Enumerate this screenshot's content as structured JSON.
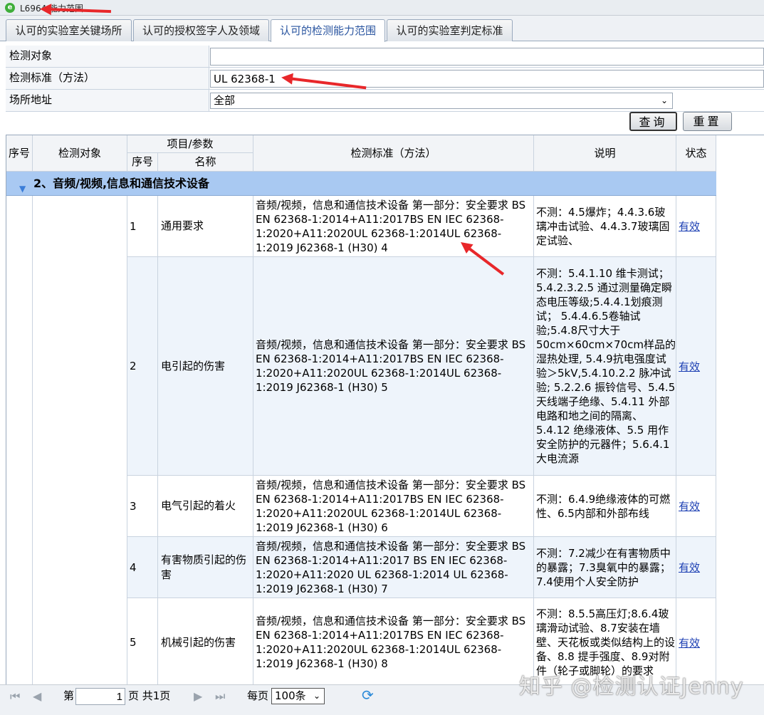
{
  "window": {
    "title": "L6964 能力范围"
  },
  "tabs": [
    {
      "label": "认可的实验室关键场所"
    },
    {
      "label": "认可的授权签字人及领域"
    },
    {
      "label": "认可的检测能力范围"
    },
    {
      "label": "认可的实验室判定标准"
    }
  ],
  "form": {
    "object_label": "检测对象",
    "object_value": "",
    "standard_label": "检测标准（方法）",
    "standard_value": "UL 62368-1",
    "site_label": "场所地址",
    "site_value": "全部",
    "query_label": "查询",
    "reset_label": "重置"
  },
  "grid": {
    "headers": {
      "seq": "序号",
      "object": "检测对象",
      "item_param": "项目/参数",
      "item_seq": "序号",
      "item_name": "名称",
      "standard": "检测标准（方法）",
      "note": "说明",
      "status": "状态"
    },
    "group_title": "2、音频/视频,信息和通信技术设备",
    "rows": [
      {
        "no": "1",
        "name": "通用要求",
        "standard": "音频/视频，信息和通信技术设备 第一部分：安全要求 BS EN 62368-1:2014+A11:2017BS EN IEC 62368-1:2020+A11:2020UL 62368-1:2014UL 62368-1:2019 J62368-1 (H30) 4",
        "note": "不测：4.5爆炸；4.4.3.6玻璃冲击试验、4.4.3.7玻璃固定试验、",
        "status": "有效"
      },
      {
        "no": "2",
        "name": "电引起的伤害",
        "standard": "音频/视频，信息和通信技术设备 第一部分：安全要求 BS EN 62368-1:2014+A11:2017BS EN IEC 62368-1:2020+A11:2020UL 62368-1:2014UL 62368-1:2019 J62368-1 (H30) 5",
        "note": "不测：5.4.1.10 维卡测试； 5.4.2.3.2.5 通过测量确定瞬态电压等级;5.4.4.1划痕测试； 5.4.4.6.5卷轴试验;5.4.8尺寸大于50cm×60cm×70cm样品的湿热处理, 5.4.9抗电强度试验＞5kV,5.4.10.2.2 脉冲试验; 5.2.2.6 振铃信号、5.4.5 天线端子绝缘、5.4.11 外部电路和地之间的隔离、5.4.12 绝缘液体、5.5 用作安全防护的元器件；5.6.4.1大电流源",
        "status": "有效"
      },
      {
        "no": "3",
        "name": "电气引起的着火",
        "standard": "音频/视频，信息和通信技术设备 第一部分：安全要求 BS EN 62368-1:2014+A11:2017BS EN IEC 62368-1:2020+A11:2020UL 62368-1:2014UL 62368-1:2019 J62368-1 (H30) 6",
        "note": "不测：6.4.9绝缘液体的可燃性、6.5内部和外部布线",
        "status": "有效"
      },
      {
        "no": "4",
        "name": "有害物质引起的伤害",
        "standard": "音频/视频，信息和通信技术设备 第一部分：安全要求 BS EN 62368-1:2014+A11:2017 BS EN IEC 62368-1:2020+A11:2020 UL 62368-1:2014 UL 62368-1:2019 J62368-1 (H30) 7",
        "note": "不测：7.2减少在有害物质中的暴露；7.3臭氧中的暴露；7.4使用个人安全防护",
        "status": "有效"
      },
      {
        "no": "5",
        "name": "机械引起的伤害",
        "standard": "音频/视频，信息和通信技术设备 第一部分：安全要求 BS EN 62368-1:2014+A11:2017BS EN IEC 62368-1:2020+A11:2020UL 62368-1:2014UL 62368-1:2019 J62368-1 (H30) 8",
        "note": "不测：8.5.5高压灯;8.6.4玻璃滑动试验、8.7安装在墙壁、天花板或类似结构上的设备、8.8 提手强度、8.9对附件（轮子或脚轮）的要求",
        "status": "有效"
      }
    ]
  },
  "pager": {
    "page_prefix": "第",
    "page_value": "1",
    "page_suffix": "页 共1页",
    "per_page_label": "每页",
    "per_page_value": "100条"
  },
  "watermark": "知乎 @检测认证Jenny"
}
